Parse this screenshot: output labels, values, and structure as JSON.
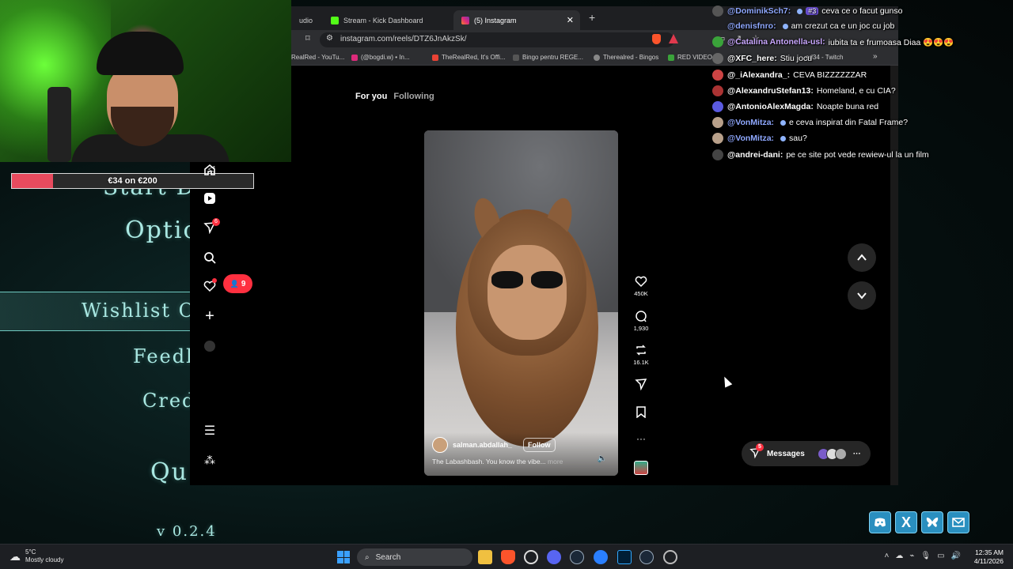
{
  "game_menu": {
    "items": [
      "Start D",
      "Optic",
      "Wishlist O",
      "Feedb",
      "Cred",
      "Qu"
    ],
    "version": "v 0.2.4"
  },
  "goal": {
    "text": "€34 on €200",
    "progress": 0.17,
    "color": "#e84b5e"
  },
  "browser": {
    "tabs": [
      {
        "label": "udio",
        "icon": "audio-tab-icon"
      },
      {
        "label": "Stream - Kick Dashboard",
        "icon": "kick-icon"
      },
      {
        "label": "(5) Instagram",
        "icon": "instagram-icon",
        "active": true
      }
    ],
    "url": "instagram.com/reels/DTZ6JnAkzSk/",
    "bookmarks": [
      "RealRed - YouTu...",
      "(@bogdi.w) • In...",
      "TheRealRed, It's Offi...",
      "Bingo pentru REGE...",
      "Therealred - Bingos",
      "RED VIDEO",
      "ed34 - Twitch"
    ]
  },
  "instagram": {
    "feed_tabs": {
      "active": "For you",
      "inactive": "Following"
    },
    "sidebar_badges": {
      "messages": "6",
      "notifications": "9"
    },
    "reel": {
      "username": "salman.abdallah_",
      "follow_label": "Follow",
      "caption": "The Labashbash. You know the vibe...",
      "more_label": "more"
    },
    "actions": {
      "likes": "450K",
      "comments": "1,930",
      "reposts": "16.1K"
    },
    "messages": {
      "label": "Messages",
      "badge": "5"
    }
  },
  "chat": [
    {
      "user": "@DominikSch7:",
      "color": "#8fa8ff",
      "badge": "#3",
      "msg": "ceva ce o facut gunso"
    },
    {
      "user": "@denisfnro:",
      "color": "#8fa8ff",
      "msg": "am crezut ca e un joc cu job"
    },
    {
      "user": "@Catalina Antonella-usl:",
      "color": "#c9a7ff",
      "msg": "iubita ta e frumoasa Diaa 😍😍😍"
    },
    {
      "user": "@XFC_here:",
      "color": "#ffffff",
      "msg": "Stiu jocu"
    },
    {
      "user": "@_iAlexandra_:",
      "color": "#ffffff",
      "msg": "CEVA BIZZZZZZAR"
    },
    {
      "user": "@AlexandruStefan13:",
      "color": "#ffffff",
      "msg": "Homeland, e cu CIA?"
    },
    {
      "user": "@AntonioAlexMagda:",
      "color": "#ffffff",
      "msg": "Noapte buna red"
    },
    {
      "user": "@VonMitza:",
      "color": "#8fa8ff",
      "msg": "e ceva inspirat din Fatal Frame?"
    },
    {
      "user": "@VonMitza:",
      "color": "#8fa8ff",
      "msg": "sau?"
    },
    {
      "user": "@andrei-dani:",
      "color": "#ffffff",
      "msg": "pe ce site pot vede rewiew-ul la un film"
    }
  ],
  "taskbar": {
    "weather_temp": "5°C",
    "weather_desc": "Mostly cloudy",
    "search_placeholder": "Search",
    "time": "12:35 AM",
    "date": "4/11/2026"
  }
}
